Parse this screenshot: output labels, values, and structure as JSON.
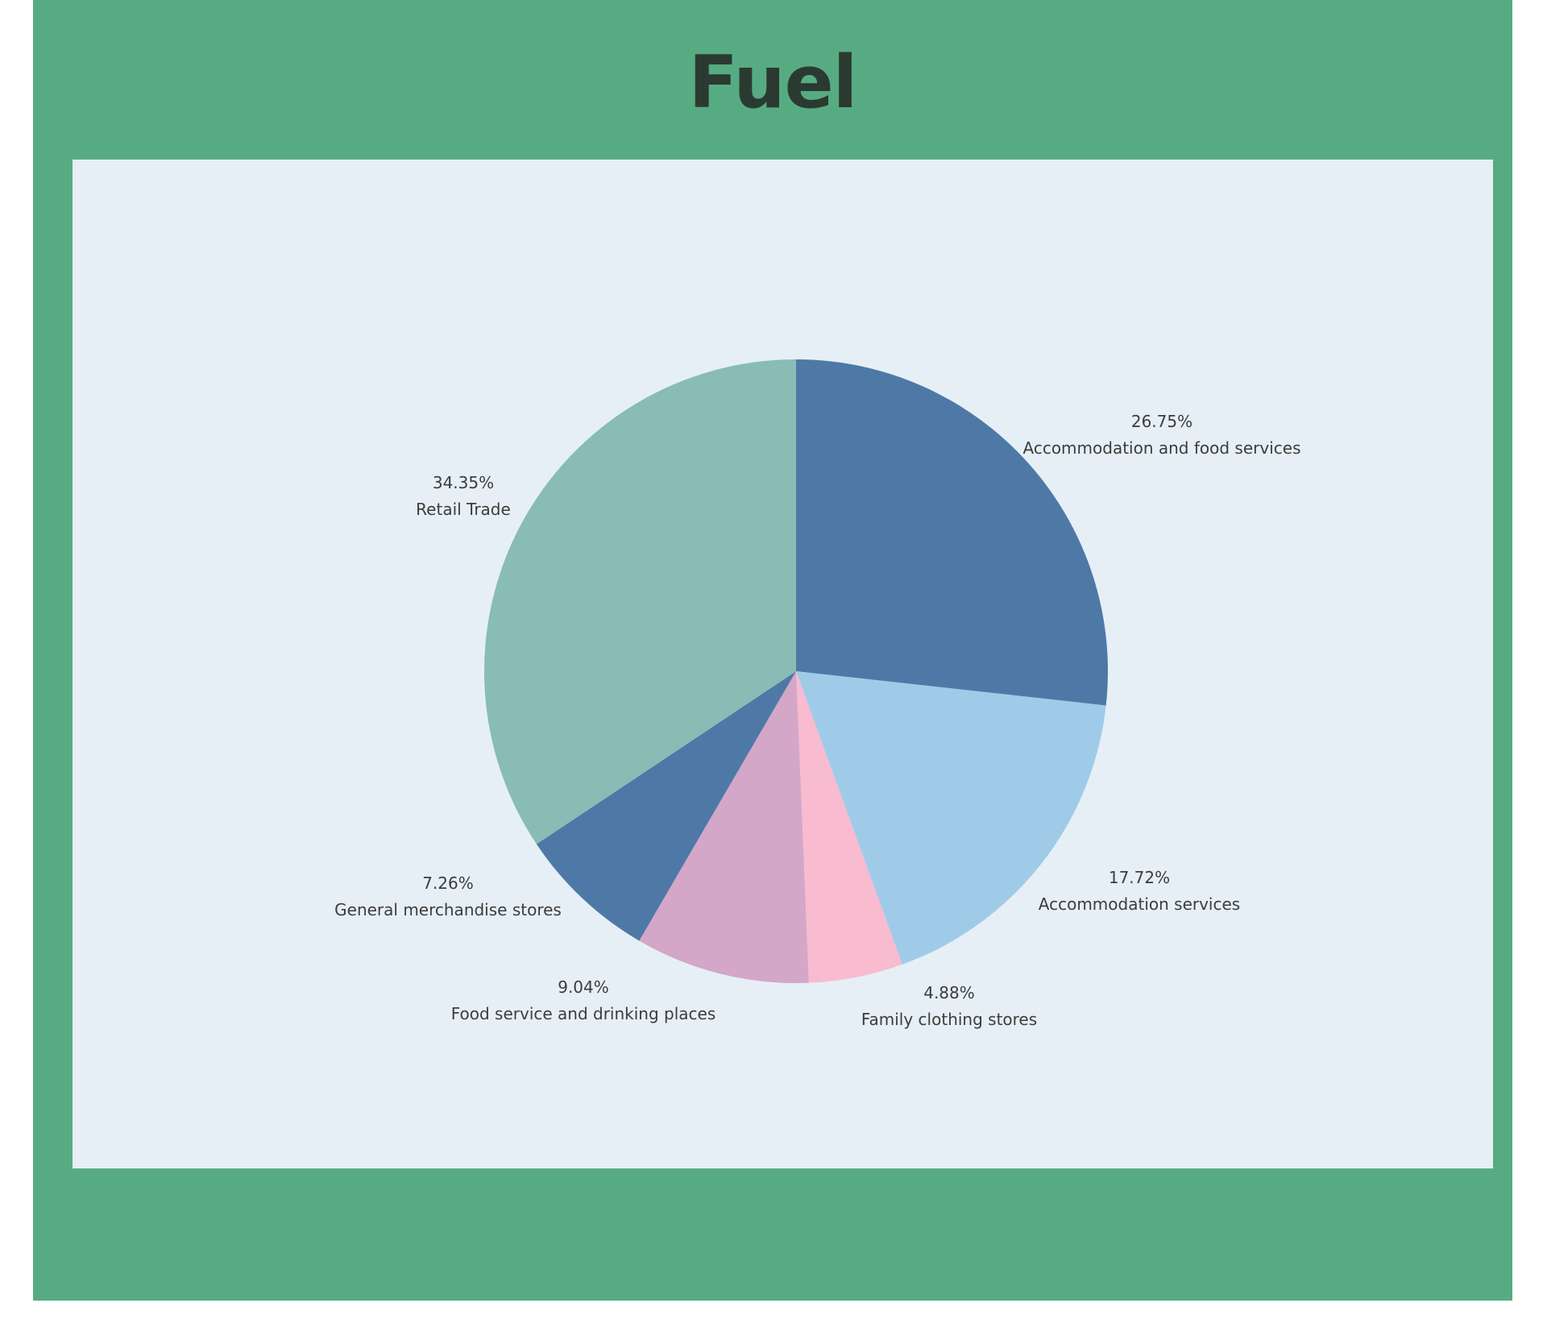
{
  "header": {
    "title": "Fuel"
  },
  "colors": {
    "background": "#57ab82",
    "chart_background": "#e6eff6",
    "title": "#2b3a30"
  },
  "chart_data": {
    "type": "pie",
    "title": "Fuel",
    "slices": [
      {
        "label": "Accommodation and food services",
        "value": 26.75,
        "value_label": "26.75%",
        "color": "#4e79a7"
      },
      {
        "label": "Accommodation services",
        "value": 17.72,
        "value_label": "17.72%",
        "color": "#a0cbe8"
      },
      {
        "label": "Family clothing stores",
        "value": 4.88,
        "value_label": "4.88%",
        "color": "#f8bbd0"
      },
      {
        "label": "Food service and drinking places",
        "value": 9.04,
        "value_label": "9.04%",
        "color": "#d4a6c8"
      },
      {
        "label": "General merchandise stores",
        "value": 7.26,
        "value_label": "7.26%",
        "color": "#4e79a7"
      },
      {
        "label": "Retail Trade",
        "value": 34.35,
        "value_label": "34.35%",
        "color": "#88bcb5"
      }
    ],
    "start_angle": "12 o'clock",
    "direction": "clockwise",
    "legend": "none"
  }
}
